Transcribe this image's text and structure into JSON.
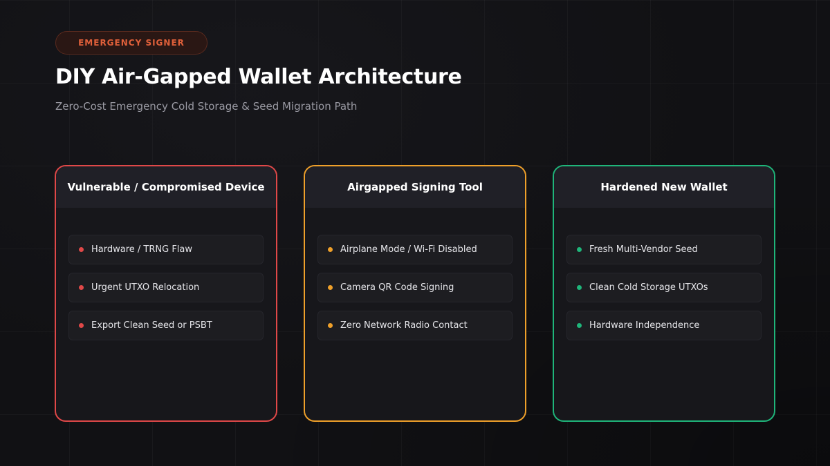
{
  "badge": {
    "label": "EMERGENCY SIGNER"
  },
  "title": "DIY Air-Gapped Wallet Architecture",
  "subtitle": "Zero-Cost Emergency Cold Storage & Seed Migration Path",
  "colors": {
    "red": "#e04848",
    "amber": "#efa02a",
    "green": "#1fb57a",
    "badge_text": "#e0603a",
    "background": "#111114"
  },
  "cards": [
    {
      "header": "Vulnerable / Compromised Device",
      "accent": "#e04848",
      "items": [
        {
          "label": "Hardware / TRNG Flaw"
        },
        {
          "label": "Urgent UTXO Relocation"
        },
        {
          "label": "Export Clean Seed or PSBT"
        }
      ]
    },
    {
      "header": "Airgapped Signing Tool",
      "accent": "#efa02a",
      "items": [
        {
          "label": "Airplane Mode / Wi-Fi Disabled"
        },
        {
          "label": "Camera QR Code Signing"
        },
        {
          "label": "Zero Network Radio Contact"
        }
      ]
    },
    {
      "header": "Hardened New Wallet",
      "accent": "#1fb57a",
      "items": [
        {
          "label": "Fresh Multi-Vendor Seed"
        },
        {
          "label": "Clean Cold Storage UTXOs"
        },
        {
          "label": "Hardware Independence"
        }
      ]
    }
  ]
}
